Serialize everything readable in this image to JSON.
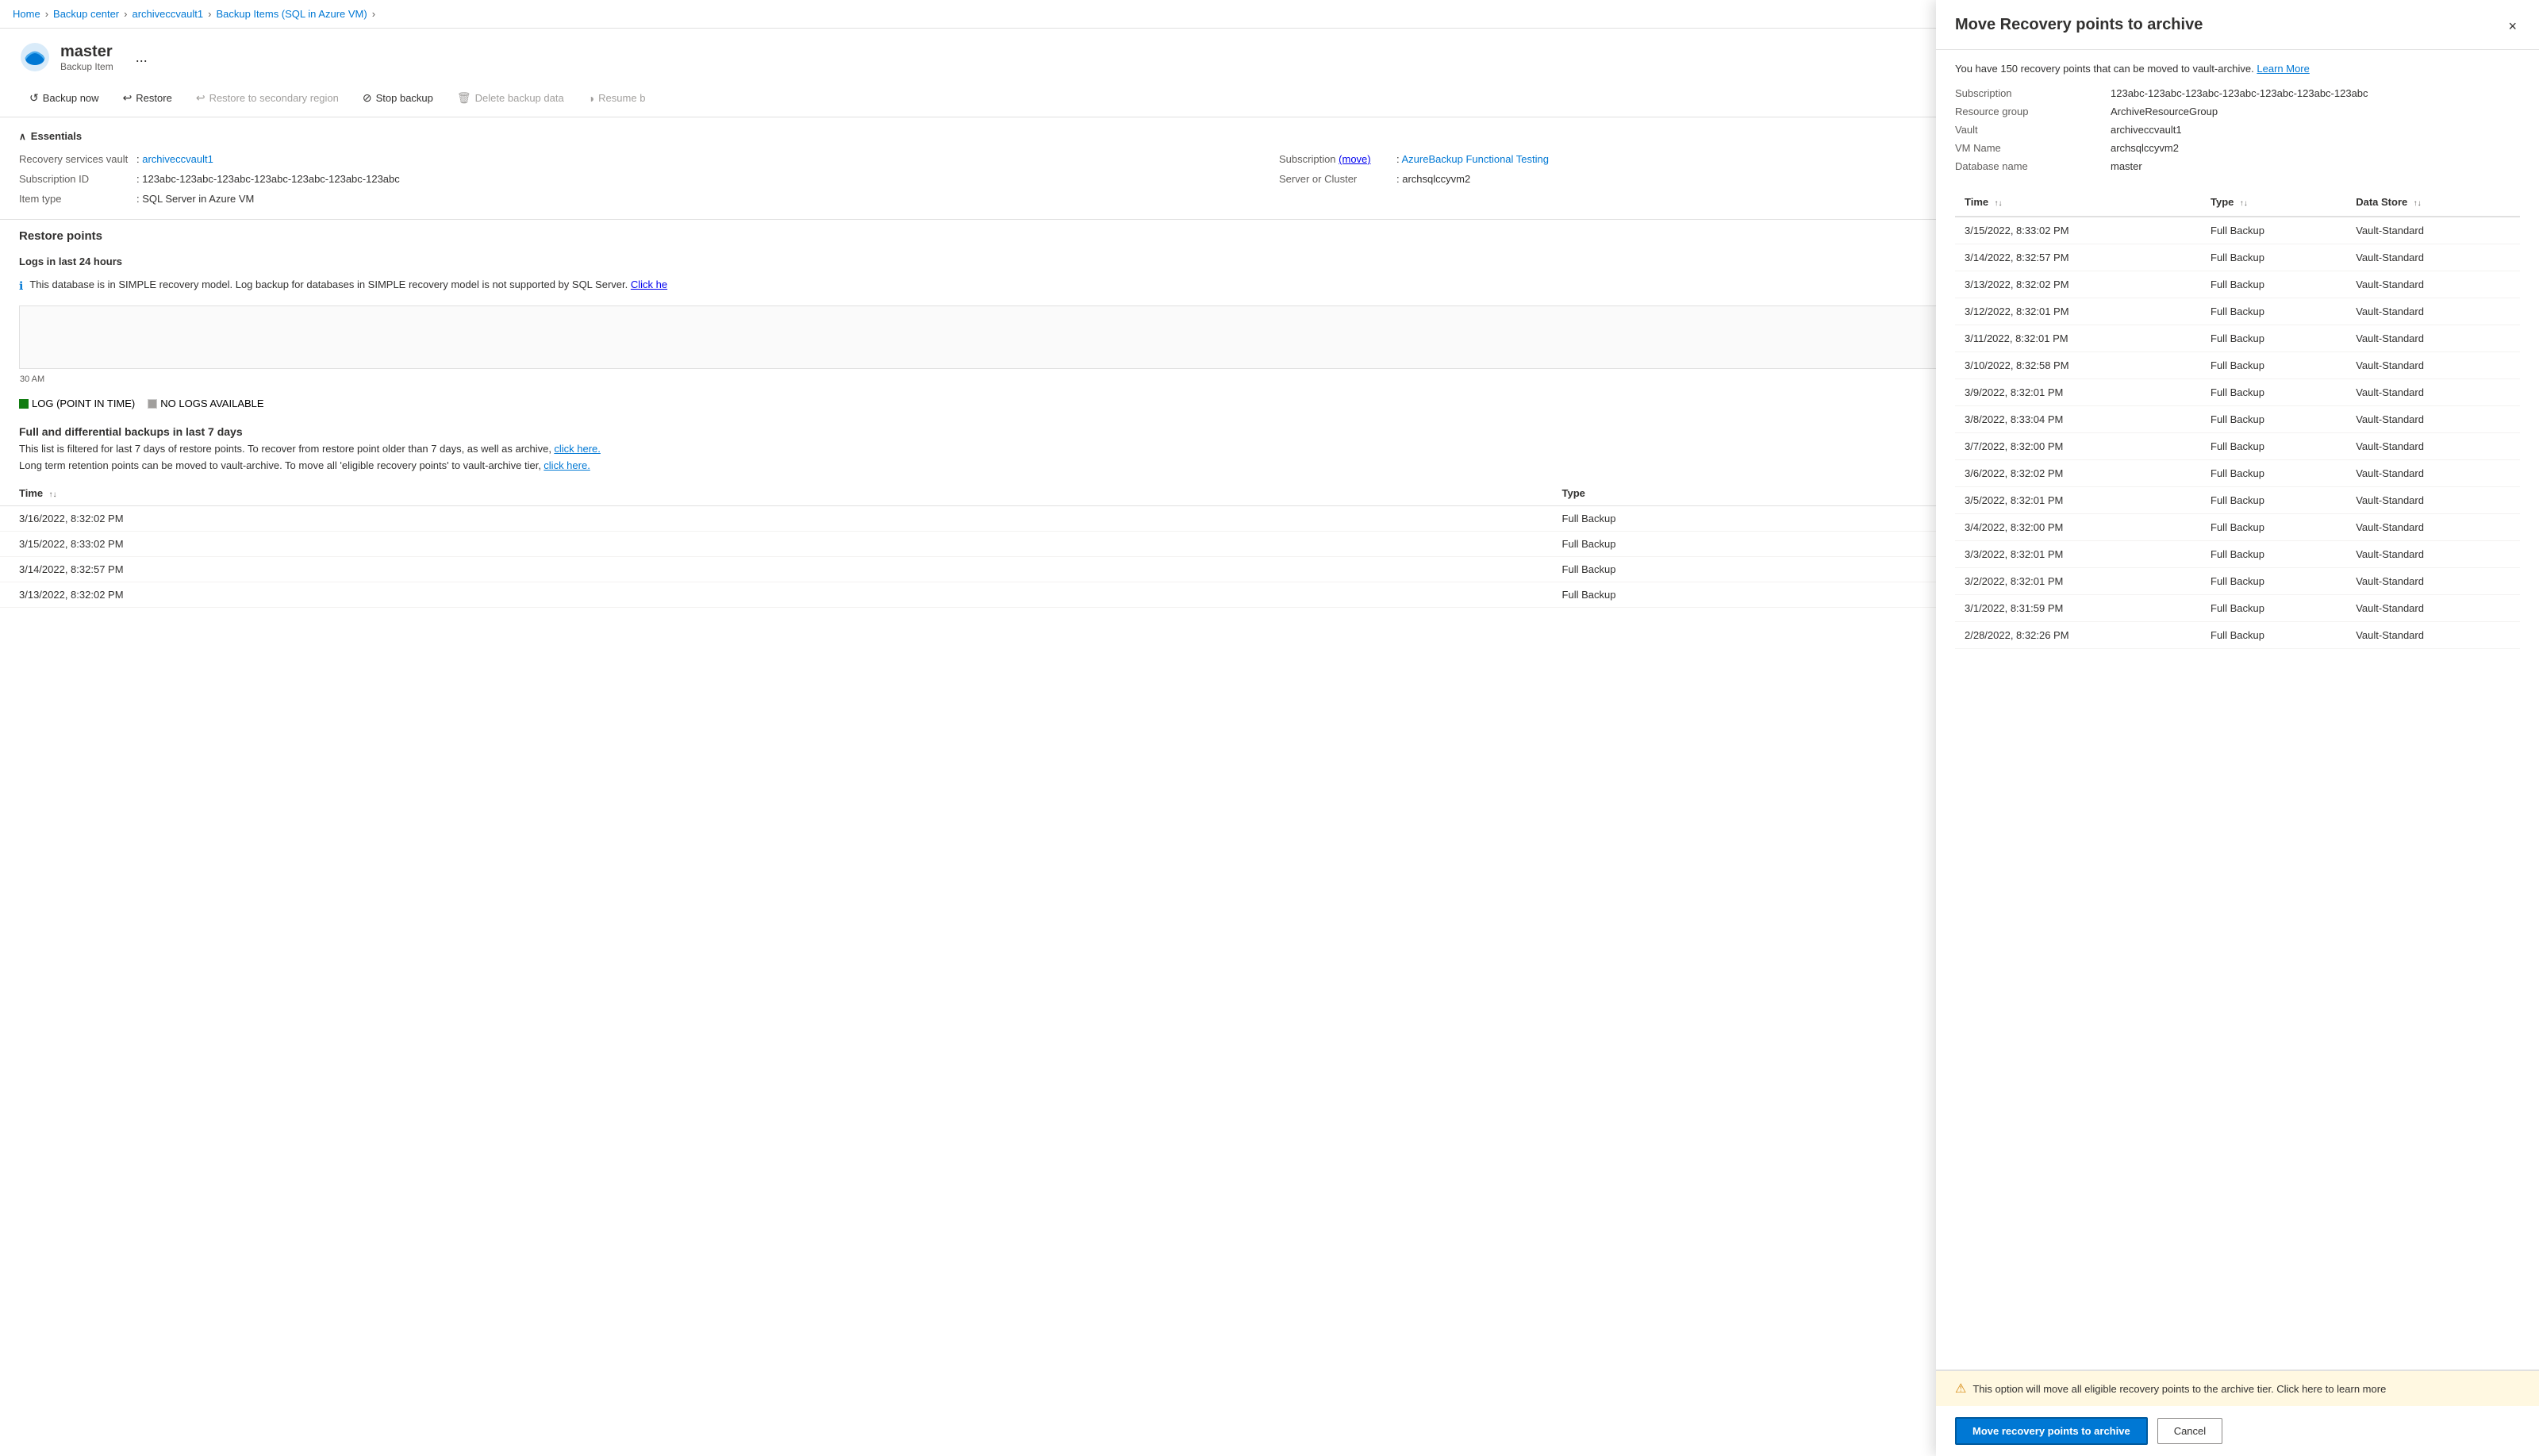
{
  "breadcrumb": {
    "items": [
      "Home",
      "Backup center",
      "archiveccvault1",
      "Backup Items (SQL in Azure VM)"
    ]
  },
  "page": {
    "title": "master",
    "subtitle": "Backup Item",
    "ellipsis": "..."
  },
  "toolbar": {
    "buttons": [
      {
        "id": "backup-now",
        "label": "Backup now",
        "icon": "↺",
        "disabled": false
      },
      {
        "id": "restore",
        "label": "Restore",
        "icon": "↩",
        "disabled": false
      },
      {
        "id": "restore-secondary",
        "label": "Restore to secondary region",
        "icon": "↩",
        "disabled": true
      },
      {
        "id": "stop-backup",
        "label": "Stop backup",
        "icon": "⊘",
        "disabled": false
      },
      {
        "id": "delete-backup",
        "label": "Delete backup data",
        "icon": "🗑",
        "disabled": true
      },
      {
        "id": "resume-backup",
        "label": "Resume b",
        "icon": "◑",
        "disabled": true
      }
    ]
  },
  "essentials": {
    "title": "Essentials",
    "fields": [
      {
        "label": "Recovery services vault",
        "value": "archiveccvault1",
        "link": true
      },
      {
        "label": "Subscription",
        "value": "AzureBackup Functional Testing",
        "link": true,
        "move_link": true
      },
      {
        "label": "Subscription ID",
        "value": "123abc-123abc-123abc-123abc-123abc-123abc-123abc"
      },
      {
        "label": "Server or Cluster",
        "value": "archsqlccyvm2"
      },
      {
        "label": "Item type",
        "value": "SQL Server in Azure VM"
      }
    ]
  },
  "restore_points": {
    "title": "Restore points"
  },
  "logs": {
    "title": "Logs in last 24 hours",
    "info_text": "This database is in SIMPLE recovery model. Log backup for databases in SIMPLE recovery model is not supported by SQL Server.",
    "info_link": "Click he",
    "chart_label": "30 AM",
    "legend": [
      {
        "label": "LOG (POINT IN TIME)",
        "color": "green"
      },
      {
        "label": "NO LOGS AVAILABLE",
        "color": "gray"
      }
    ]
  },
  "full_diff": {
    "title": "Full and differential backups in last 7 days",
    "filter_text": "This list is filtered for last 7 days of restore points. To recover from restore point older than 7 days, as well as archive,",
    "filter_link": "click here.",
    "archive_text": "Long term retention points can be moved to vault-archive. To move all 'eligible recovery points' to vault-archive tier,",
    "archive_link": "click here.",
    "columns": [
      {
        "label": "Time",
        "sort": true
      },
      {
        "label": "Type",
        "sort": false
      }
    ],
    "rows": [
      {
        "time": "3/16/2022, 8:32:02 PM",
        "type": "Full Backup"
      },
      {
        "time": "3/15/2022, 8:33:02 PM",
        "type": "Full Backup"
      },
      {
        "time": "3/14/2022, 8:32:57 PM",
        "type": "Full Backup"
      },
      {
        "time": "3/13/2022, 8:32:02 PM",
        "type": "Full Backup"
      }
    ]
  },
  "panel": {
    "title": "Move Recovery points to archive",
    "close_label": "×",
    "description": "You have 150 recovery points that can be moved to vault-archive.",
    "learn_more": "Learn More",
    "meta": [
      {
        "label": "Subscription",
        "value": "123abc-123abc-123abc-123abc-123abc-123abc-123abc"
      },
      {
        "label": "Resource group",
        "value": "ArchiveResourceGroup"
      },
      {
        "label": "Vault",
        "value": "archiveccvault1"
      },
      {
        "label": "VM Name",
        "value": "archsqlccyvm2"
      },
      {
        "label": "Database name",
        "value": "master"
      }
    ],
    "table_columns": [
      {
        "label": "Time",
        "sort": "↑↓"
      },
      {
        "label": "Type",
        "sort": "↑↓"
      },
      {
        "label": "Data Store",
        "sort": "↑↓"
      }
    ],
    "table_rows": [
      {
        "time": "3/15/2022, 8:33:02 PM",
        "type": "Full Backup",
        "store": "Vault-Standard"
      },
      {
        "time": "3/14/2022, 8:32:57 PM",
        "type": "Full Backup",
        "store": "Vault-Standard"
      },
      {
        "time": "3/13/2022, 8:32:02 PM",
        "type": "Full Backup",
        "store": "Vault-Standard"
      },
      {
        "time": "3/12/2022, 8:32:01 PM",
        "type": "Full Backup",
        "store": "Vault-Standard"
      },
      {
        "time": "3/11/2022, 8:32:01 PM",
        "type": "Full Backup",
        "store": "Vault-Standard"
      },
      {
        "time": "3/10/2022, 8:32:58 PM",
        "type": "Full Backup",
        "store": "Vault-Standard"
      },
      {
        "time": "3/9/2022, 8:32:01 PM",
        "type": "Full Backup",
        "store": "Vault-Standard"
      },
      {
        "time": "3/8/2022, 8:33:04 PM",
        "type": "Full Backup",
        "store": "Vault-Standard"
      },
      {
        "time": "3/7/2022, 8:32:00 PM",
        "type": "Full Backup",
        "store": "Vault-Standard"
      },
      {
        "time": "3/6/2022, 8:32:02 PM",
        "type": "Full Backup",
        "store": "Vault-Standard"
      },
      {
        "time": "3/5/2022, 8:32:01 PM",
        "type": "Full Backup",
        "store": "Vault-Standard"
      },
      {
        "time": "3/4/2022, 8:32:00 PM",
        "type": "Full Backup",
        "store": "Vault-Standard"
      },
      {
        "time": "3/3/2022, 8:32:01 PM",
        "type": "Full Backup",
        "store": "Vault-Standard"
      },
      {
        "time": "3/2/2022, 8:32:01 PM",
        "type": "Full Backup",
        "store": "Vault-Standard"
      },
      {
        "time": "3/1/2022, 8:31:59 PM",
        "type": "Full Backup",
        "store": "Vault-Standard"
      },
      {
        "time": "2/28/2022, 8:32:26 PM",
        "type": "Full Backup",
        "store": "Vault-Standard"
      }
    ],
    "warning_text": "This option will move all eligible recovery points to the archive tier. Click here to learn more",
    "action_btn": "Move recovery points to archive",
    "cancel_btn": "Cancel"
  }
}
